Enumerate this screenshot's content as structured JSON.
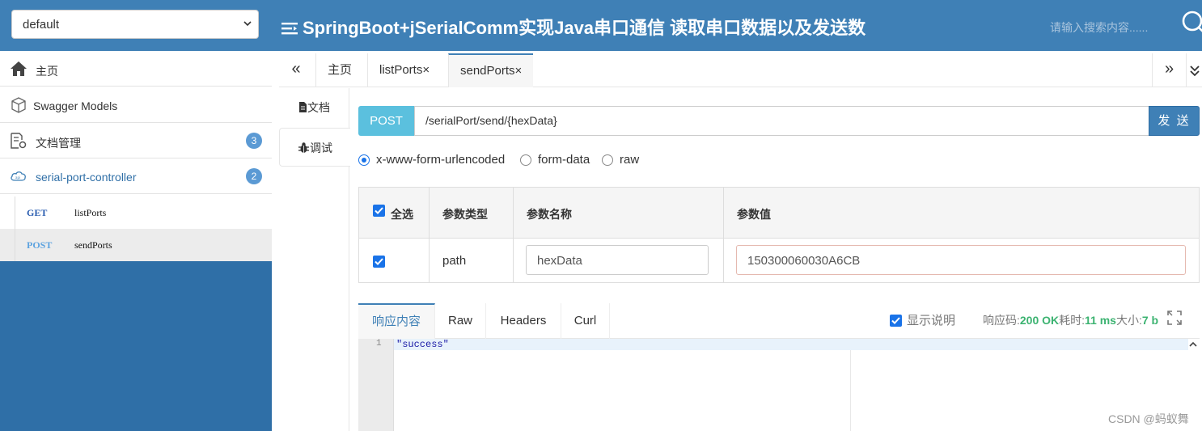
{
  "header": {
    "project_select": "default",
    "title": "SpringBoot+jSerialComm实现Java串口通信 读取串口数据以及发送数",
    "search_placeholder": "请输入搜索内容......"
  },
  "sidebar": {
    "items": [
      {
        "label": "主页",
        "icon": "home-icon"
      },
      {
        "label": "Swagger Models",
        "icon": "cube-icon"
      },
      {
        "label": "文档管理",
        "icon": "document-settings-icon",
        "badge": "3"
      },
      {
        "label": "serial-port-controller",
        "icon": "cloud-icon",
        "badge": "2"
      }
    ],
    "endpoints": [
      {
        "method": "GET",
        "path": "listPorts",
        "method_color": "#2a5db0"
      },
      {
        "method": "POST",
        "path": "sendPorts",
        "method_color": "#5da3e0"
      }
    ]
  },
  "tabs": {
    "left_arrow": "«",
    "right_arrow": "»",
    "items": [
      {
        "label": "主页"
      },
      {
        "label": "listPorts×"
      },
      {
        "label": "sendPorts×"
      }
    ]
  },
  "vtabs": {
    "doc": "文档",
    "debug": "调试"
  },
  "request": {
    "method": "POST",
    "url": "/serialPort/send/{hexData}",
    "send_label": "发 送",
    "body_types": [
      "x-www-form-urlencoded",
      "form-data",
      "raw"
    ],
    "selected_body_type": "x-www-form-urlencoded"
  },
  "params": {
    "headers": {
      "select_all": "全选",
      "type": "参数类型",
      "name": "参数名称",
      "value": "参数值"
    },
    "rows": [
      {
        "checked": true,
        "type": "path",
        "name": "hexData",
        "value": "150300060030A6CB"
      }
    ]
  },
  "response": {
    "tabs": [
      "响应内容",
      "Raw",
      "Headers",
      "Curl"
    ],
    "show_desc": "显示说明",
    "status_label": "响应码:",
    "status_value": "200 OK",
    "time_label": "耗时:",
    "time_value": "11 ms",
    "size_label": "大小:",
    "size_value": "7 b",
    "line_number": "1",
    "body": "\"success\""
  },
  "watermark": "CSDN @蚂蚁舞",
  "colors": {
    "header_bg": "#3f80b6",
    "sidebar_bg": "#2f6fa7",
    "post_badge": "#5bc0de",
    "accent_green": "#3cb371"
  }
}
